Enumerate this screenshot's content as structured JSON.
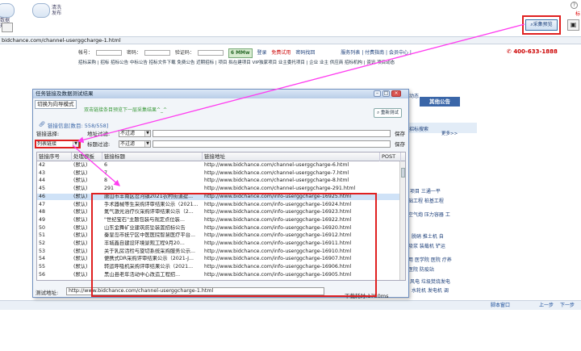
{
  "toolbar": {
    "buttons": [
      {
        "label": "数据\n规范"
      },
      {
        "label": "清洗\n发布"
      }
    ],
    "collect_button": "采集预览",
    "save_icon": "save-icon",
    "help_icon": "?",
    "red_mark": "标"
  },
  "address_bar": {
    "url": "bidchance.com/channel-userggcharge-1.html"
  },
  "webpage": {
    "login": {
      "account_label": "帐号：",
      "password_label": "密码：",
      "captcha_label": "验证码：",
      "captcha_value": "6 MMw",
      "login_link": "登录",
      "free_trial": "免费试用",
      "forgot_password": "密码找回",
      "service_links": "服务列表 | 付费指南 | 会员中心 |",
      "hotline": "400-633-1888"
    },
    "nav_links": "招标采购 | 招标 招标公告 中标公告 招标文件下载 免费公告 近期招标 | 项目 拟在建项目 VIP独家项目 业主委托项目 | 企业 业主 供应商 招标机构 | 资讯 项目动态",
    "side": {
      "item1": "动态",
      "item2": "招标搜索",
      "item3": "保存",
      "tab_active": "其他公告",
      "more": "更多>>",
      "line1": "项目 三通一平",
      "line2": "础工程 桩基工程",
      "line3": "空气炮 压力容器 工",
      "line4": "脱硝 推土机 自",
      "line5": "吸浆 装载机 铲运",
      "line6": "用 医学院 医院 疗养",
      "line7": "医院 防疫站",
      "line8": "风电 垃圾焚烧发电",
      "line9": "水轮机 发电机 调"
    }
  },
  "popup": {
    "title": "任务链接及数据测试结果",
    "mode_tab": "切换为向导模式",
    "hint": "双击链接条目预览下一层采集结果^_^",
    "retest": "重新测试",
    "link_info": "链接信息[数目: 558/558]",
    "filter1": {
      "label": "链接选择:",
      "addr_label": "地址过滤:",
      "select": "不过滤",
      "save": "保存"
    },
    "filter2": {
      "select_left": "列表链接",
      "title_label": "标题过滤:",
      "select": "不过滤",
      "save": "保存"
    },
    "table": {
      "headers": [
        "链接序号",
        "处理模板",
        "链接标题",
        "链接地址",
        "POST"
      ],
      "rows": [
        {
          "idx": "42",
          "tpl": "(默认)",
          "title": "6",
          "url": "http://www.bidchance.com/channel-userggcharge-6.html",
          "selected": false
        },
        {
          "idx": "43",
          "tpl": "(默认)",
          "title": "7",
          "url": "http://www.bidchance.com/channel-userggcharge-7.html",
          "selected": false
        },
        {
          "idx": "44",
          "tpl": "(默认)",
          "title": "8",
          "url": "http://www.bidchance.com/channel-userggcharge-8.html",
          "selected": false
        },
        {
          "idx": "45",
          "tpl": "(默认)",
          "title": "291",
          "url": "http://www.bidchance.com/channel-userggcharge-291.html",
          "selected": false
        },
        {
          "idx": "46",
          "tpl": "(默认)",
          "title": "唐山市丰南区岔河镇2021农村街道提...",
          "url": "http://www.bidchance.com/info-userggcharge-16925.html",
          "selected": true
        },
        {
          "idx": "47",
          "tpl": "(默认)",
          "title": "手术器械等生采购评审结果公示（2021...",
          "url": "http://www.bidchance.com/info-userggcharge-16924.html",
          "selected": false
        },
        {
          "idx": "48",
          "tpl": "(默认)",
          "title": "氮气激光治疗仪采购评审结果公示（2...",
          "url": "http://www.bidchance.com/info-userggcharge-16923.html",
          "selected": false
        },
        {
          "idx": "49",
          "tpl": "(默认)",
          "title": "\"世纪宝石\"主题包装与规定点位装...",
          "url": "http://www.bidchance.com/info-userggcharge-16922.html",
          "selected": false
        },
        {
          "idx": "50",
          "tpl": "(默认)",
          "title": "山东金舞矿业建筑防坠装置招标公告",
          "url": "http://www.bidchance.com/info-userggcharge-16920.html",
          "selected": false
        },
        {
          "idx": "51",
          "tpl": "(默认)",
          "title": "秦皇岛市抚宁区中医医院智慧医疗平台...",
          "url": "http://www.bidchance.com/info-userggcharge-16912.html",
          "selected": false
        },
        {
          "idx": "52",
          "tpl": "(默认)",
          "title": "丰城鑫自建设环境景观工程9月20...",
          "url": "http://www.bidchance.com/info-userggcharge-16911.html",
          "selected": false
        },
        {
          "idx": "53",
          "tpl": "(默认)",
          "title": "关于乳房活检与旋切系统采购服务公示...",
          "url": "http://www.bidchance.com/info-userggcharge-16910.html",
          "selected": false
        },
        {
          "idx": "54",
          "tpl": "(默认)",
          "title": "便携式DR采购评审结果公示（2021-J...",
          "url": "http://www.bidchance.com/info-userggcharge-16907.html",
          "selected": false
        },
        {
          "idx": "55",
          "tpl": "(默认)",
          "title": "转运呼吸机采购评审结果公示（2021...",
          "url": "http://www.bidchance.com/info-userggcharge-16906.html",
          "selected": false
        },
        {
          "idx": "56",
          "tpl": "(默认)",
          "title": "黑山县老年活动中心改造工程招...",
          "url": "http://www.bidchance.com/info-userggcharge-16905.html",
          "selected": false
        }
      ]
    },
    "test_address_label": "测试地址:",
    "test_address": "http://www.bidchance.com/channel-userggcharge-1.html",
    "timing": "下载耗时:1750ms"
  },
  "statusbar": {
    "left": "脚本窗口",
    "prev": "上一步",
    "next": "下一步"
  },
  "colors": {
    "highlight": "#e02020",
    "arrow": "#ff3cf0",
    "accent": "#3a66a8"
  }
}
